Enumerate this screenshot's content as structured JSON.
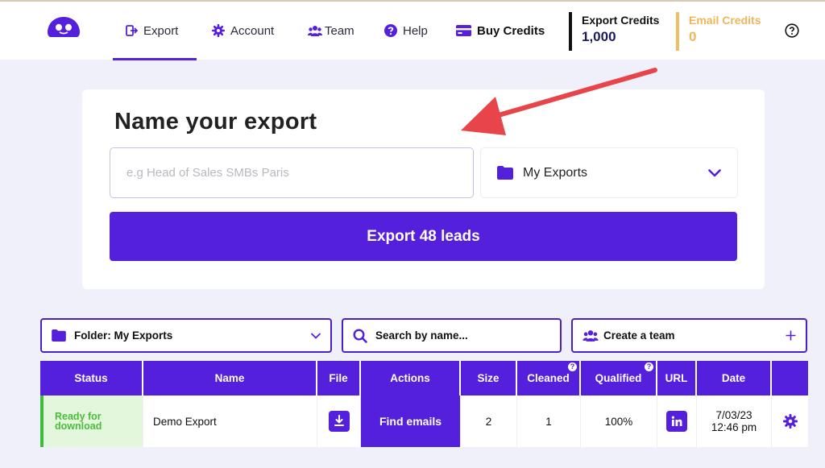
{
  "nav": {
    "items": [
      {
        "label": "Export",
        "icon": "export-icon"
      },
      {
        "label": "Account",
        "icon": "gear-icon"
      },
      {
        "label": "Team",
        "icon": "users-icon"
      },
      {
        "label": "Help",
        "icon": "help-icon"
      },
      {
        "label": "Buy Credits",
        "icon": "credit-card-icon"
      }
    ],
    "active": "Export"
  },
  "credits": {
    "export_label": "Export Credits",
    "export_value": "1,000",
    "email_label": "Email Credits",
    "email_value": "0"
  },
  "export_card": {
    "title": "Name your export",
    "name_placeholder": "e.g Head of Sales SMBs Paris",
    "folder_value": "My Exports",
    "export_button": "Export 48 leads"
  },
  "controls": {
    "folder_label": "Folder: My Exports",
    "search_placeholder": "Search by name...",
    "team_label": "Create a team"
  },
  "table": {
    "columns": [
      "Status",
      "Name",
      "File",
      "Actions",
      "Size",
      "Cleaned",
      "Qualified",
      "URL",
      "Date",
      ""
    ],
    "rows": [
      {
        "status": "Ready for download",
        "name": "Demo Export",
        "action": "Find emails",
        "size": "2",
        "cleaned": "1",
        "qualified": "100%",
        "date_line1": "7/03/23",
        "date_line2": "12:46 pm"
      }
    ]
  },
  "colors": {
    "primary": "#5520dc",
    "email_credits": "#f2b459",
    "status_ready_bg": "#e3f7dc",
    "status_ready_text": "#4cbc3c",
    "arrow": "#e8454a"
  }
}
